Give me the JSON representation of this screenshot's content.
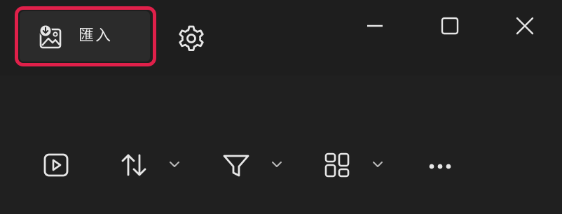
{
  "titlebar": {
    "import_label": "匯入",
    "import_icon": "image-import-icon",
    "settings_icon": "gear-icon",
    "window_controls": {
      "minimize_icon": "minimize-icon",
      "maximize_icon": "maximize-icon",
      "close_icon": "close-icon"
    },
    "highlight_color": "#e0204a"
  },
  "toolbar": {
    "items": [
      {
        "icon": "slideshow-play-icon"
      },
      {
        "icon": "sort-icon",
        "has_dropdown": true
      },
      {
        "icon": "filter-icon",
        "has_dropdown": true
      },
      {
        "icon": "view-layout-icon",
        "has_dropdown": true
      },
      {
        "icon": "more-options-icon"
      }
    ]
  },
  "colors": {
    "background": "#1f1f1f",
    "button_bg": "#2b2b2b",
    "icon": "#e6e6e6"
  }
}
